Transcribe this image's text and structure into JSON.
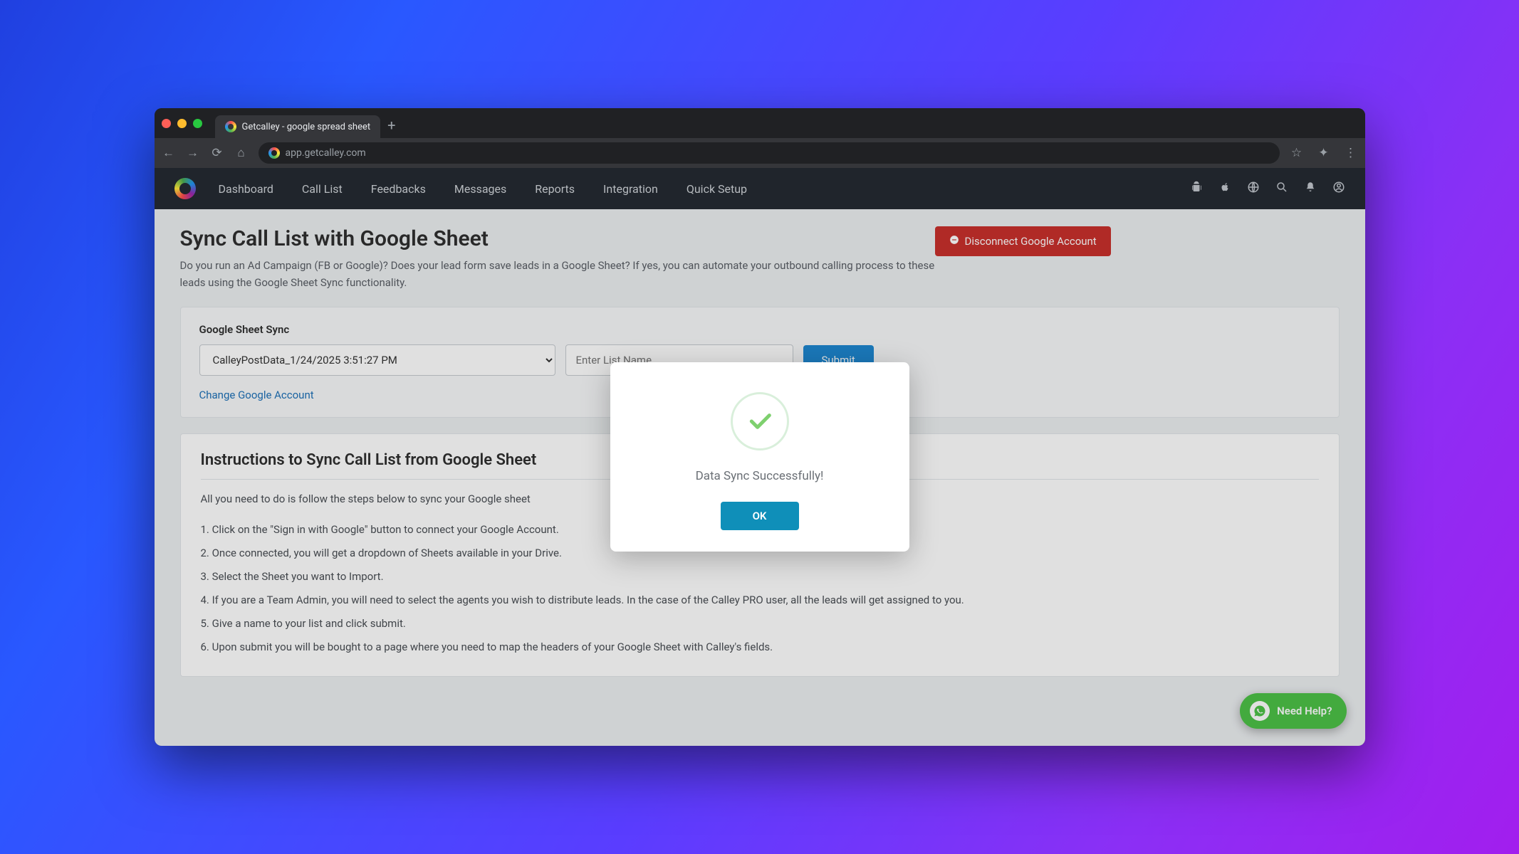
{
  "browser": {
    "tab_title": "Getcalley - google spread sheet",
    "url": "app.getcalley.com"
  },
  "nav": {
    "items": [
      "Dashboard",
      "Call List",
      "Feedbacks",
      "Messages",
      "Reports",
      "Integration",
      "Quick Setup"
    ]
  },
  "page": {
    "title": "Sync Call List with Google Sheet",
    "subtitle": "Do you run an Ad Campaign (FB or Google)? Does your lead form save leads in a Google Sheet? If yes, you can automate your outbound calling process to these leads using the Google Sheet Sync functionality.",
    "disconnect_label": "Disconnect Google Account"
  },
  "sync": {
    "section_label": "Google Sheet Sync",
    "selected_sheet": "CalleyPostData_1/24/2025 3:51:27 PM",
    "list_name_placeholder": "Enter List Name",
    "submit_label": "Submit",
    "change_link": "Change Google Account"
  },
  "instructions": {
    "title": "Instructions to Sync Call List from Google Sheet",
    "lead": "All you need to do is follow the steps below to sync your Google sheet",
    "steps": [
      "1. Click on the \"Sign in with Google\" button to connect your Google Account.",
      "2. Once connected, you will get a dropdown of Sheets available in your Drive.",
      "3. Select the Sheet you want to Import.",
      "4. If you are a Team Admin, you will need to select the agents you wish to distribute leads. In the case of the Calley PRO user, all the leads will get assigned to you.",
      "5. Give a name to your list and click submit.",
      "6. Upon submit you will be bought to a page where you need to map the headers of your Google Sheet with Calley's fields."
    ]
  },
  "modal": {
    "message": "Data Sync Successfully!",
    "ok_label": "OK"
  },
  "help": {
    "label": "Need Help?"
  }
}
